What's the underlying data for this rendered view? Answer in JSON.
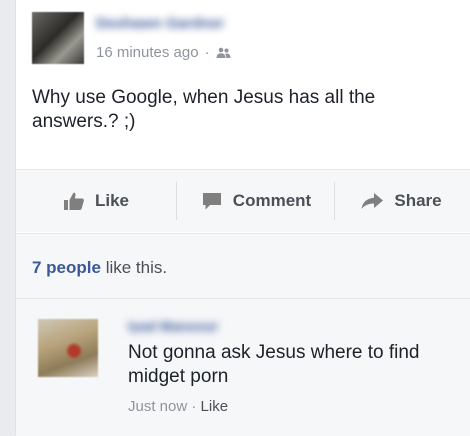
{
  "post": {
    "author_name": "Deshawn Gardner",
    "time_label": "16 minutes ago",
    "separator": "·",
    "privacy_icon": "friends-icon",
    "text": "Why use Google, when Jesus has all the answers.? ;)"
  },
  "actions": {
    "like_label": "Like",
    "like_icon": "thumbs-up-icon",
    "comment_label": "Comment",
    "comment_icon": "speech-bubble-icon",
    "share_label": "Share",
    "share_icon": "share-arrow-icon"
  },
  "likes": {
    "count_label": "7 people",
    "suffix": " like this."
  },
  "comment": {
    "author_name": "Iyad Mansour",
    "text": "Not gonna ask Jesus where to find midget porn",
    "time_label": "Just now",
    "separator": " · ",
    "like_label": "Like"
  },
  "colors": {
    "link_blue": "#3b5998",
    "meta_gray": "#90949c",
    "action_gray": "#4b4f56",
    "panel_bg": "#f6f7f9"
  }
}
